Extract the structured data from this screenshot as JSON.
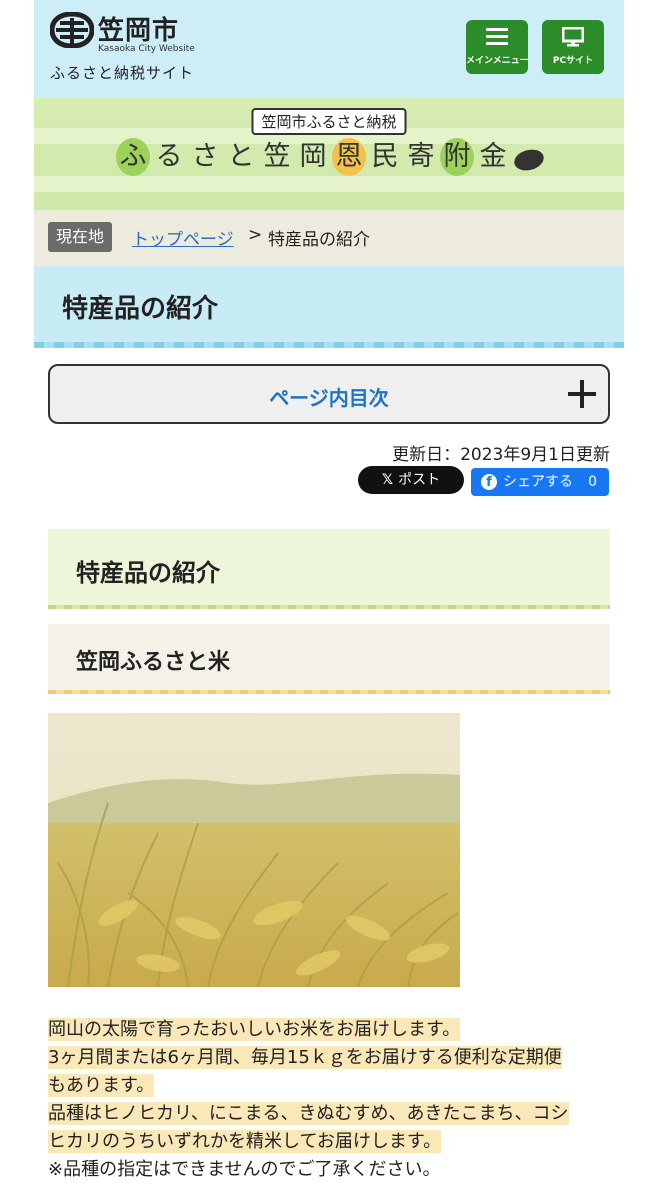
{
  "header": {
    "logo_city": "笠岡市",
    "logo_sub": "Kasaoka City Website",
    "site_name": "ふるさと納税サイト",
    "menu_button": "メインメニュー",
    "pc_button": "PCサイト"
  },
  "banner": {
    "tag": "笠岡市ふるさと納税",
    "title_chars": [
      "ふ",
      "る",
      "さ",
      "と",
      "笠",
      "岡",
      "恩",
      "民",
      "寄",
      "附",
      "金"
    ]
  },
  "breadcrumb": {
    "badge": "現在地",
    "home_link": "トップページ",
    "separator": ">",
    "current": "特産品の紹介"
  },
  "page": {
    "title": "特産品の紹介",
    "toc_label": "ページ内目次",
    "updated": "更新日：2023年9月1日更新"
  },
  "share": {
    "x_label": "ポスト",
    "fb_label": "シェアする",
    "fb_count": "0"
  },
  "content": {
    "section_heading": "特産品の紹介",
    "subsection_heading": "笠岡ふるさと米",
    "paragraph_lines": [
      "岡山の太陽で育ったおいしいお米をお届けします。",
      "3ヶ月間または6ヶ月間、毎月15ｋｇをお届けする便利な定期便",
      "もあります。",
      "品種はヒノヒカリ、にこまる、きぬむすめ、あきたこまち、コシ",
      "ヒカリのうちいずれかを精米してお届けします。",
      "※品種の指定はできませんのでご了承ください。"
    ]
  },
  "colors": {
    "header_bg": "#cdeef8",
    "header_button": "#2c8c2a",
    "link": "#2b6cc2",
    "toc_label": "#1f73c6",
    "highlight": "#fbe8b8"
  }
}
